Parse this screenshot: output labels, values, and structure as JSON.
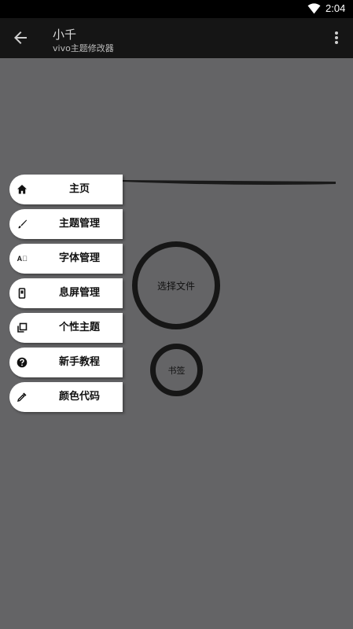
{
  "status_bar": {
    "time": "2:04",
    "icons": [
      "wifi-icon"
    ]
  },
  "app_bar": {
    "title": "小千",
    "subtitle": "vivo主题修改器",
    "icons": [
      "back-arrow-icon",
      "more-vert-icon"
    ]
  },
  "menu": {
    "items": [
      {
        "label": "主页",
        "icon": "home-icon"
      },
      {
        "label": "主题管理",
        "icon": "brush-icon"
      },
      {
        "label": "字体管理",
        "icon": "font-icon",
        "icon_text": "A⃝"
      },
      {
        "label": "息屏管理",
        "icon": "phone-icon"
      },
      {
        "label": "个性主题",
        "icon": "layers-icon"
      },
      {
        "label": "新手教程",
        "icon": "help-icon"
      },
      {
        "label": "颜色代码",
        "icon": "eyedropper-icon"
      }
    ]
  },
  "actions": {
    "select_file": "选择文件",
    "bookmark": "书签"
  },
  "colors": {
    "background": "#646466",
    "app_bar": "#151515",
    "status_bar": "#000000",
    "menu_item": "#ffffff",
    "circle_border": "#161616"
  }
}
